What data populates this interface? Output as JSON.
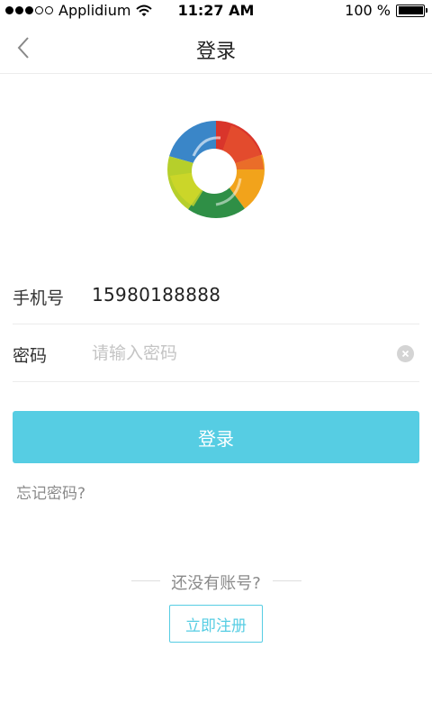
{
  "status_bar": {
    "carrier": "Applidium",
    "time": "11:27 AM",
    "battery": "100 %",
    "signal_icon": "signal-dots-icon",
    "wifi_icon": "wifi-icon",
    "battery_icon": "battery-icon"
  },
  "nav": {
    "title": "登录",
    "back_icon": "chevron-left-icon"
  },
  "logo": {
    "icon": "app-logo-ring"
  },
  "form": {
    "phone_label": "手机号",
    "phone_value": "15980188888",
    "password_label": "密码",
    "password_placeholder": "请输入密码",
    "clear_icon": "clear-icon"
  },
  "actions": {
    "login_label": "登录",
    "forgot_label": "忘记密码?",
    "no_account_text": "还没有账号?",
    "register_label": "立即注册"
  },
  "colors": {
    "accent": "#56cde3",
    "muted_text": "#8a8a8a",
    "placeholder": "#c4c4c4"
  }
}
